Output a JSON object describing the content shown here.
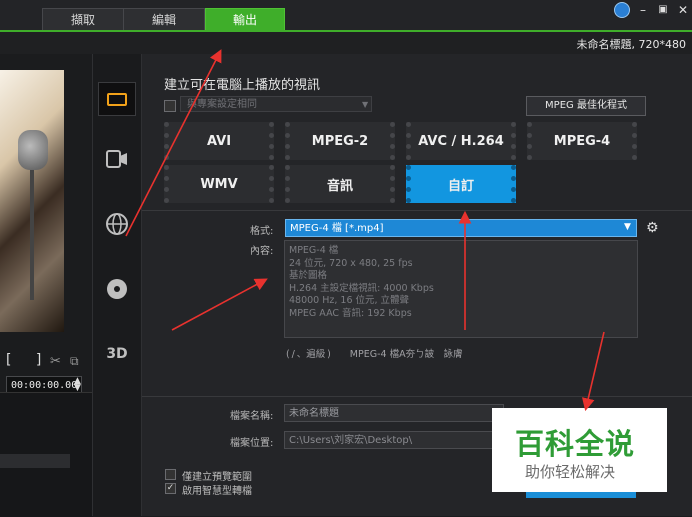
{
  "tabs": [
    {
      "label": "擷取",
      "active": false
    },
    {
      "label": "編輯",
      "active": false
    },
    {
      "label": "輸出",
      "active": true
    }
  ],
  "window": {
    "minimize": "–",
    "restore": "▣",
    "close": "✕"
  },
  "project_info": "未命名標題, 720*480",
  "preview": {
    "mark_controls": "[ ]",
    "timecode": "00:00:00.00"
  },
  "rail": {
    "items": [
      {
        "name": "computer-icon",
        "active": true
      },
      {
        "name": "device-icon",
        "active": false
      },
      {
        "name": "globe-icon",
        "active": false
      },
      {
        "name": "disc-icon",
        "active": false
      },
      {
        "name": "3d-icon",
        "label": "3D",
        "active": false
      }
    ]
  },
  "main": {
    "heading": "建立可在電腦上播放的視訊",
    "preset_placeholder": "與專案設定相同",
    "mpeg_optimizer": "MPEG 最佳化程式",
    "formats": [
      {
        "label": "AVI",
        "selected": false
      },
      {
        "label": "MPEG-2",
        "selected": false
      },
      {
        "label": "AVC / H.264",
        "selected": false
      },
      {
        "label": "MPEG-4",
        "selected": false
      },
      {
        "label": "WMV",
        "selected": false
      },
      {
        "label": "音訊",
        "selected": false
      },
      {
        "label": "自訂",
        "selected": true
      }
    ],
    "format_label": "格式:",
    "format_value": "MPEG-4 檔 [*.mp4]",
    "content_label": "內容:",
    "content_lines": [
      "MPEG-4 檔",
      "24 位元, 720 x 480, 25 fps",
      "基於圖格",
      "H.264 主設定檔視訊: 4000 Kbps",
      "48000 Hz, 16 位元, 立體聲",
      "MPEG AAC 音訊: 192 Kbps"
    ],
    "estimate": "( / 、遍級 )  MPEG-4 檔A夯ㄅ詖 詠膚",
    "file_name_label": "檔案名稱:",
    "file_name_value": "未命名標題",
    "file_location_label": "檔案位置:",
    "file_location_value": "C:\\Users\\刘家宏\\Desktop\\",
    "option1_label": "僅建立預覽範圍",
    "option2_label": "啟用智慧型轉檔"
  },
  "watermark": {
    "main": "百科全说",
    "sub": "助你轻松解决"
  },
  "colors": {
    "accent_green": "#3fae2a",
    "selected_blue": "#1296e0",
    "arrow_red": "#e8322e"
  }
}
